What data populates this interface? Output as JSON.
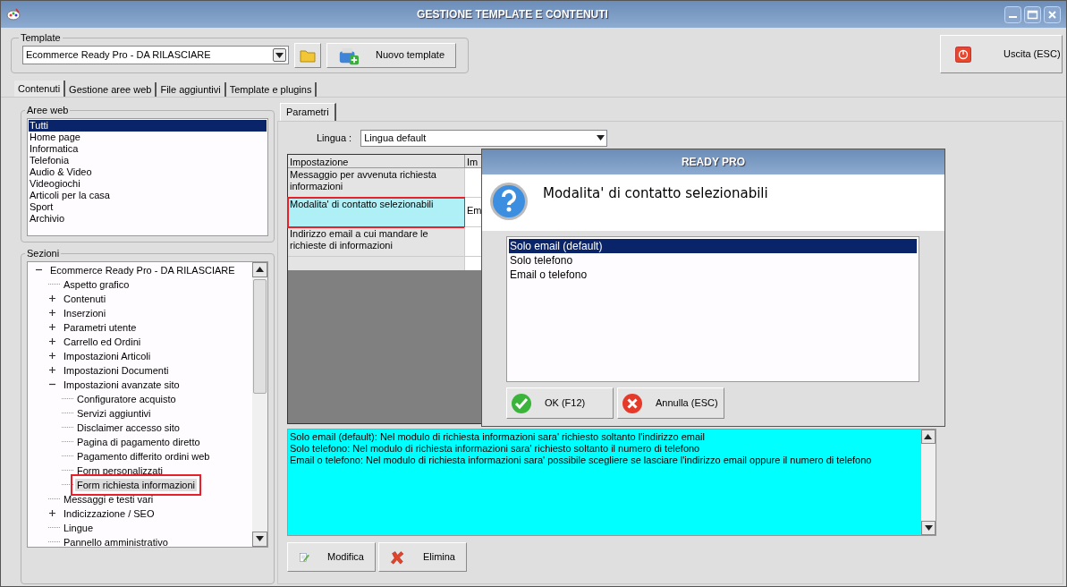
{
  "window": {
    "title": "GESTIONE TEMPLATE E CONTENUTI"
  },
  "template": {
    "label": "Template",
    "value": "Ecommerce Ready Pro - DA RILASCIARE",
    "new_button": "Nuovo template"
  },
  "exit_button": "Uscita (ESC)",
  "tabs": [
    {
      "label": "Contenuti",
      "selected": true
    },
    {
      "label": "Gestione aree web",
      "selected": false
    },
    {
      "label": "File aggiuntivi",
      "selected": false
    },
    {
      "label": "Template e plugins",
      "selected": false
    }
  ],
  "web_areas": {
    "label": "Aree web",
    "items": [
      {
        "label": "Tutti",
        "selected": true
      },
      {
        "label": "Home page",
        "selected": false
      },
      {
        "label": "Informatica",
        "selected": false
      },
      {
        "label": "Telefonia",
        "selected": false
      },
      {
        "label": "Audio & Video",
        "selected": false
      },
      {
        "label": "Videogiochi",
        "selected": false
      },
      {
        "label": "Articoli per la casa",
        "selected": false
      },
      {
        "label": "Sport",
        "selected": false
      },
      {
        "label": "Archivio",
        "selected": false
      }
    ]
  },
  "sections": {
    "label": "Sezioni",
    "tree": [
      {
        "label": "Ecommerce Ready Pro - DA RILASCIARE",
        "expanded": true,
        "selected": false,
        "highlighted": false,
        "children": [
          {
            "label": "Aspetto grafico",
            "selected": false,
            "highlighted": false
          },
          {
            "label": "Contenuti",
            "expanded": false,
            "selected": false,
            "highlighted": false
          },
          {
            "label": "Inserzioni",
            "expanded": false,
            "selected": false,
            "highlighted": false
          },
          {
            "label": "Parametri utente",
            "expanded": false,
            "selected": false,
            "highlighted": false
          },
          {
            "label": "Carrello ed Ordini",
            "expanded": false,
            "selected": false,
            "highlighted": false
          },
          {
            "label": "Impostazioni Articoli",
            "expanded": false,
            "selected": false,
            "highlighted": false
          },
          {
            "label": "Impostazioni Documenti",
            "expanded": false,
            "selected": false,
            "highlighted": false
          },
          {
            "label": "Impostazioni avanzate sito",
            "expanded": true,
            "selected": false,
            "highlighted": false,
            "children": [
              {
                "label": "Configuratore acquisto",
                "selected": false,
                "highlighted": false
              },
              {
                "label": "Servizi aggiuntivi",
                "selected": false,
                "highlighted": false
              },
              {
                "label": "Disclaimer accesso sito",
                "selected": false,
                "highlighted": false
              },
              {
                "label": "Pagina di pagamento diretto",
                "selected": false,
                "highlighted": false
              },
              {
                "label": "Pagamento differito ordini web",
                "selected": false,
                "highlighted": false
              },
              {
                "label": "Form personalizzati",
                "selected": false,
                "highlighted": false
              },
              {
                "label": "Form richiesta informazioni",
                "selected": true,
                "highlighted": true
              }
            ]
          },
          {
            "label": "Messaggi e testi vari",
            "selected": false,
            "highlighted": false
          },
          {
            "label": "Indicizzazione / SEO",
            "expanded": false,
            "selected": false,
            "highlighted": false
          },
          {
            "label": "Lingue",
            "selected": false,
            "highlighted": false
          },
          {
            "label": "Pannello amministrativo",
            "selected": false,
            "highlighted": false
          }
        ]
      }
    ]
  },
  "params_tab": {
    "label": "Parametri"
  },
  "language": {
    "label": "Lingua :",
    "value": "Lingua default"
  },
  "table": {
    "columns": [
      "Impostazione",
      "Im"
    ],
    "rows": [
      {
        "setting": "Messaggio per avvenuta richiesta informazioni",
        "selected": false,
        "highlighted": false
      },
      {
        "setting": "Modalita' di contatto selezionabili",
        "column_2": "Em",
        "selected": true,
        "highlighted": true
      },
      {
        "setting": "Indirizzo email a cui mandare le richieste di informazioni",
        "selected": false,
        "highlighted": false
      }
    ]
  },
  "description": [
    "Solo email (default): Nel modulo di richiesta informazioni sara' richiesto soltanto l'indirizzo email",
    "Solo telefono: Nel modulo di richiesta informazioni sara' richiesto soltanto il numero di telefono",
    "Email o telefono: Nel modulo di richiesta informazioni sara' possibile scegliere se lasciare l'indirizzo email oppure il numero di telefono"
  ],
  "buttons": [
    {
      "label": "Modifica",
      "kind": "edit"
    },
    {
      "label": "Elimina",
      "kind": "delete"
    }
  ],
  "dialog": {
    "title": "READY PRO",
    "heading": "Modalita' di contatto selezionabili",
    "options": [
      {
        "label": "Solo email (default)",
        "selected": true
      },
      {
        "label": "Solo telefono",
        "selected": false
      },
      {
        "label": "Email o telefono",
        "selected": false
      }
    ],
    "buttons": [
      {
        "label": "OK (F12)",
        "kind": "ok"
      },
      {
        "label": "Annulla (ESC)",
        "kind": "cancel"
      }
    ]
  }
}
